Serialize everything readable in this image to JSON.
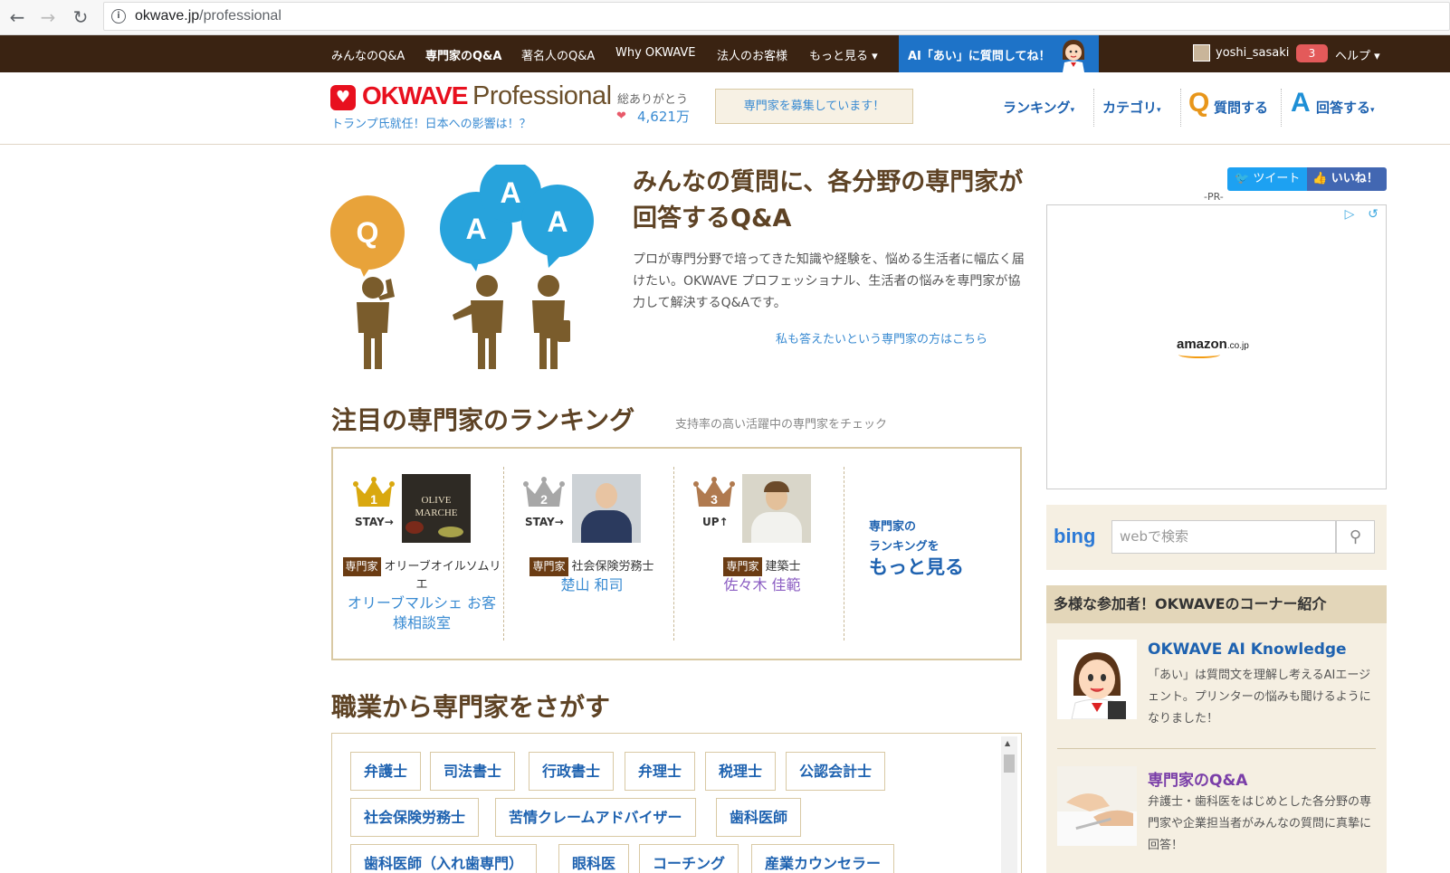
{
  "browser": {
    "url_host": "okwave.jp",
    "url_path": "/professional"
  },
  "topnav": {
    "items": [
      "みんなのQ&A",
      "専門家のQ&A",
      "著名人のQ&A",
      "Why OKWAVE",
      "法人のお客様",
      "もっと見る ▾"
    ],
    "ai_label": "AI「あい」に質問してね！",
    "username": "yoshi_sasaki",
    "notif_count": "3",
    "help": "ヘルプ ▾"
  },
  "header": {
    "logo_main": "OKWAVE",
    "logo_sub": "Professional",
    "tagline": "トランプ氏就任！日本への影響は！？",
    "thanks_label": "総ありがとう",
    "thanks_count": "4,621万",
    "recruit": "専門家を募集しています！",
    "nav": {
      "ranking": "ランキング",
      "category": "カテゴリ",
      "ask": "質問する",
      "answer": "回答する"
    }
  },
  "hero": {
    "title": "みんなの質問に、各分野の専門家が回答するQ&A",
    "desc": "プロが専門分野で培ってきた知識や経験を、悩める生活者に幅広く届けたい。OKWAVE プロフェッショナル、生活者の悩みを専門家が協力して解決するQ&Aです。",
    "link": "私も答えたいという専門家の方はこちら"
  },
  "ranking": {
    "title": "注目の専門家のランキング",
    "subtitle": "支持率の高い活躍中の専門家をチェック",
    "tag": "専門家",
    "items": [
      {
        "rank": "1",
        "status": "STAY→",
        "profession": "オリーブオイルソムリエ",
        "name": "オリーブマルシェ お客様相談室",
        "crown_color": "#d9a80f",
        "photo_label": "OLIVE MARCHE"
      },
      {
        "rank": "2",
        "status": "STAY→",
        "profession": "社会保険労務士",
        "name": "楚山 和司",
        "crown_color": "#a7a7a7"
      },
      {
        "rank": "3",
        "status": "UP↑",
        "profession": "建築士",
        "name": "佐々木 佳範",
        "crown_color": "#b07a4f"
      }
    ],
    "more_line1": "専門家の",
    "more_line2": "ランキングを",
    "more_line3": "もっと見る"
  },
  "jobs": {
    "title": "職業から専門家をさがす",
    "items": [
      "弁護士",
      "司法書士",
      "行政書士",
      "弁理士",
      "税理士",
      "公認会計士",
      "社会保険労務士",
      "苦情クレームアドバイザー",
      "歯科医師",
      "歯科医師（入れ歯専門）",
      "眼科医",
      "コーチング",
      "産業カウンセラー"
    ]
  },
  "sidebar": {
    "tweet": "ツイート",
    "like": "いいね！",
    "pr": "-PR-",
    "ad_brand": "amazon",
    "ad_brand_suffix": ".co.jp",
    "bing_logo": "bing",
    "bing_placeholder": "webで検索",
    "corner_title": "多様な参加者！OKWAVEのコーナー紹介",
    "corners": [
      {
        "title": "OKWAVE AI Knowledge",
        "desc": "「あい」は質問文を理解し考えるAIエージェント。プリンターの悩みも聞けるようになりました！"
      },
      {
        "title": "専門家のQ&A",
        "desc": "弁護士・歯科医をはじめとした各分野の専門家や企業担当者がみんなの質問に真摯に回答！"
      }
    ]
  },
  "colors": {
    "brand_red": "#e8101e",
    "brown": "#5e4325",
    "link_blue": "#1e62b0",
    "nav_bg": "#3a2312",
    "ai_blue": "#1e73c8"
  }
}
